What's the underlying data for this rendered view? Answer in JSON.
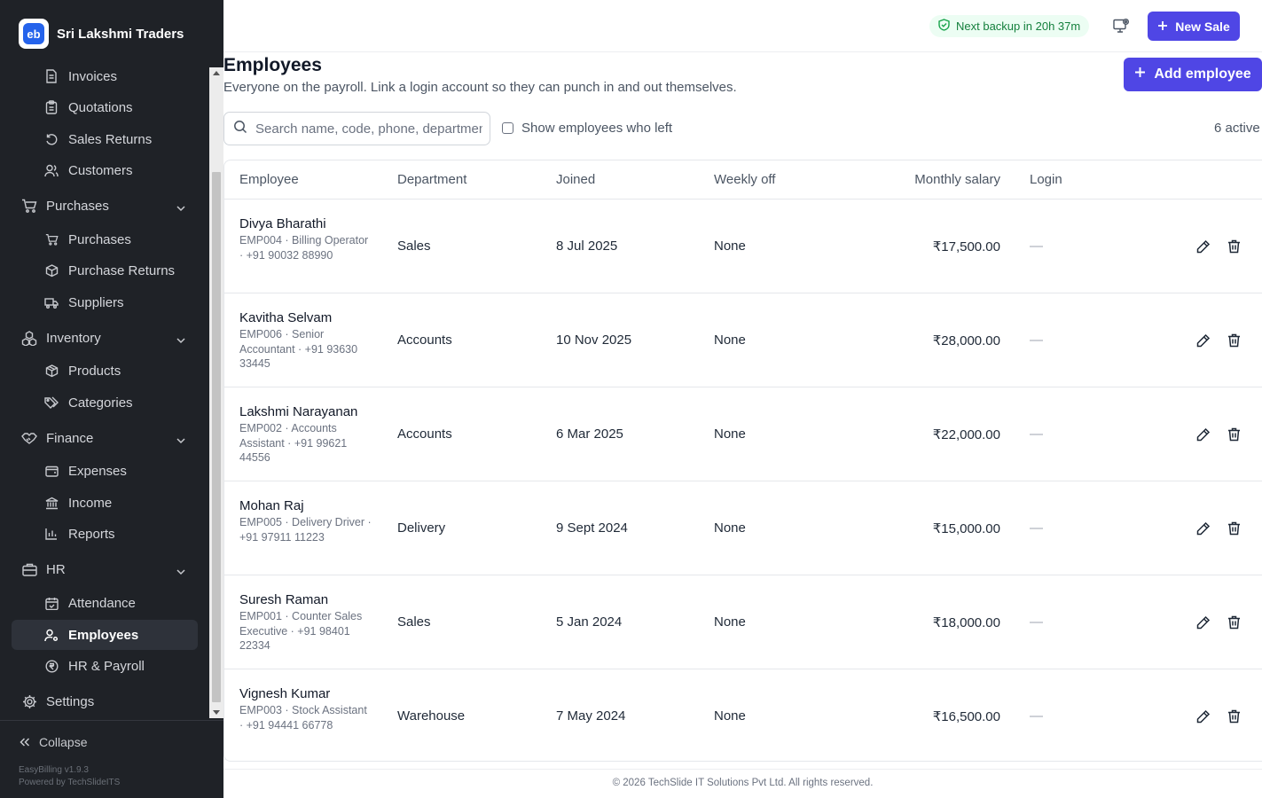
{
  "brand": {
    "name": "Sri Lakshmi Traders"
  },
  "sidebar": {
    "items": [
      {
        "label": "Invoices",
        "icon": "file-icon",
        "type": "sub"
      },
      {
        "label": "Quotations",
        "icon": "clipboard-icon",
        "type": "sub"
      },
      {
        "label": "Sales Returns",
        "icon": "rotate-icon",
        "type": "sub"
      },
      {
        "label": "Customers",
        "icon": "users-icon",
        "type": "sub"
      },
      {
        "label": "Purchases",
        "icon": "cart-icon",
        "type": "group"
      },
      {
        "label": "Purchases",
        "icon": "cart-icon",
        "type": "sub"
      },
      {
        "label": "Purchase Returns",
        "icon": "package-return-icon",
        "type": "sub"
      },
      {
        "label": "Suppliers",
        "icon": "truck-icon",
        "type": "sub"
      },
      {
        "label": "Inventory",
        "icon": "boxes-icon",
        "type": "group"
      },
      {
        "label": "Products",
        "icon": "box-icon",
        "type": "sub"
      },
      {
        "label": "Categories",
        "icon": "tags-icon",
        "type": "sub"
      },
      {
        "label": "Finance",
        "icon": "handshake-icon",
        "type": "group"
      },
      {
        "label": "Expenses",
        "icon": "wallet-icon",
        "type": "sub"
      },
      {
        "label": "Income",
        "icon": "bank-icon",
        "type": "sub"
      },
      {
        "label": "Reports",
        "icon": "bar-chart-icon",
        "type": "sub"
      },
      {
        "label": "HR",
        "icon": "briefcase-icon",
        "type": "group"
      },
      {
        "label": "Attendance",
        "icon": "calendar-check-icon",
        "type": "sub"
      },
      {
        "label": "Employees",
        "icon": "user-cog-icon",
        "type": "sub",
        "active": true
      },
      {
        "label": "HR & Payroll",
        "icon": "rupee-circle-icon",
        "type": "sub"
      },
      {
        "label": "Settings",
        "icon": "gear-icon",
        "type": "group"
      }
    ],
    "collapse_label": "Collapse",
    "version": "EasyBilling v1.9.3",
    "powered_by": "Powered by TechSlideITS"
  },
  "topbar": {
    "backup_text": "Next backup in 20h 37m",
    "new_sale_label": "New Sale"
  },
  "page": {
    "title": "Employees",
    "subtitle": "Everyone on the payroll. Link a login account so they can punch in and out themselves.",
    "add_label": "Add employee",
    "search_placeholder": "Search name, code, phone, department",
    "show_left_label": "Show employees who left",
    "active_count": "6 active"
  },
  "table": {
    "columns": [
      "Employee",
      "Department",
      "Joined",
      "Weekly off",
      "Monthly salary",
      "Login"
    ],
    "rows": [
      {
        "name": "Divya Bharathi",
        "meta": "EMP004 · Billing Operator · +91 90032 88990",
        "department": "Sales",
        "joined": "8 Jul 2025",
        "weekly_off": "None",
        "salary": "₹17,500.00",
        "login": "—"
      },
      {
        "name": "Kavitha Selvam",
        "meta": "EMP006 · Senior Accountant · +91 93630 33445",
        "department": "Accounts",
        "joined": "10 Nov 2025",
        "weekly_off": "None",
        "salary": "₹28,000.00",
        "login": "—"
      },
      {
        "name": "Lakshmi Narayanan",
        "meta": "EMP002 · Accounts Assistant · +91 99621 44556",
        "department": "Accounts",
        "joined": "6 Mar 2025",
        "weekly_off": "None",
        "salary": "₹22,000.00",
        "login": "—"
      },
      {
        "name": "Mohan Raj",
        "meta": "EMP005 · Delivery Driver · +91 97911 11223",
        "department": "Delivery",
        "joined": "9 Sept 2024",
        "weekly_off": "None",
        "salary": "₹15,000.00",
        "login": "—"
      },
      {
        "name": "Suresh Raman",
        "meta": "EMP001 · Counter Sales Executive · +91 98401 22334",
        "department": "Sales",
        "joined": "5 Jan 2024",
        "weekly_off": "None",
        "salary": "₹18,000.00",
        "login": "—"
      },
      {
        "name": "Vignesh Kumar",
        "meta": "EMP003 · Stock Assistant · +91 94441 66778",
        "department": "Warehouse",
        "joined": "7 May 2024",
        "weekly_off": "None",
        "salary": "₹16,500.00",
        "login": "—"
      }
    ]
  },
  "footer": {
    "text": "© 2026 TechSlide IT Solutions Pvt Ltd. All rights reserved."
  },
  "colors": {
    "accent": "#4f46e5",
    "sidebar_bg": "#1f2227",
    "backup_green": "#15803d"
  }
}
